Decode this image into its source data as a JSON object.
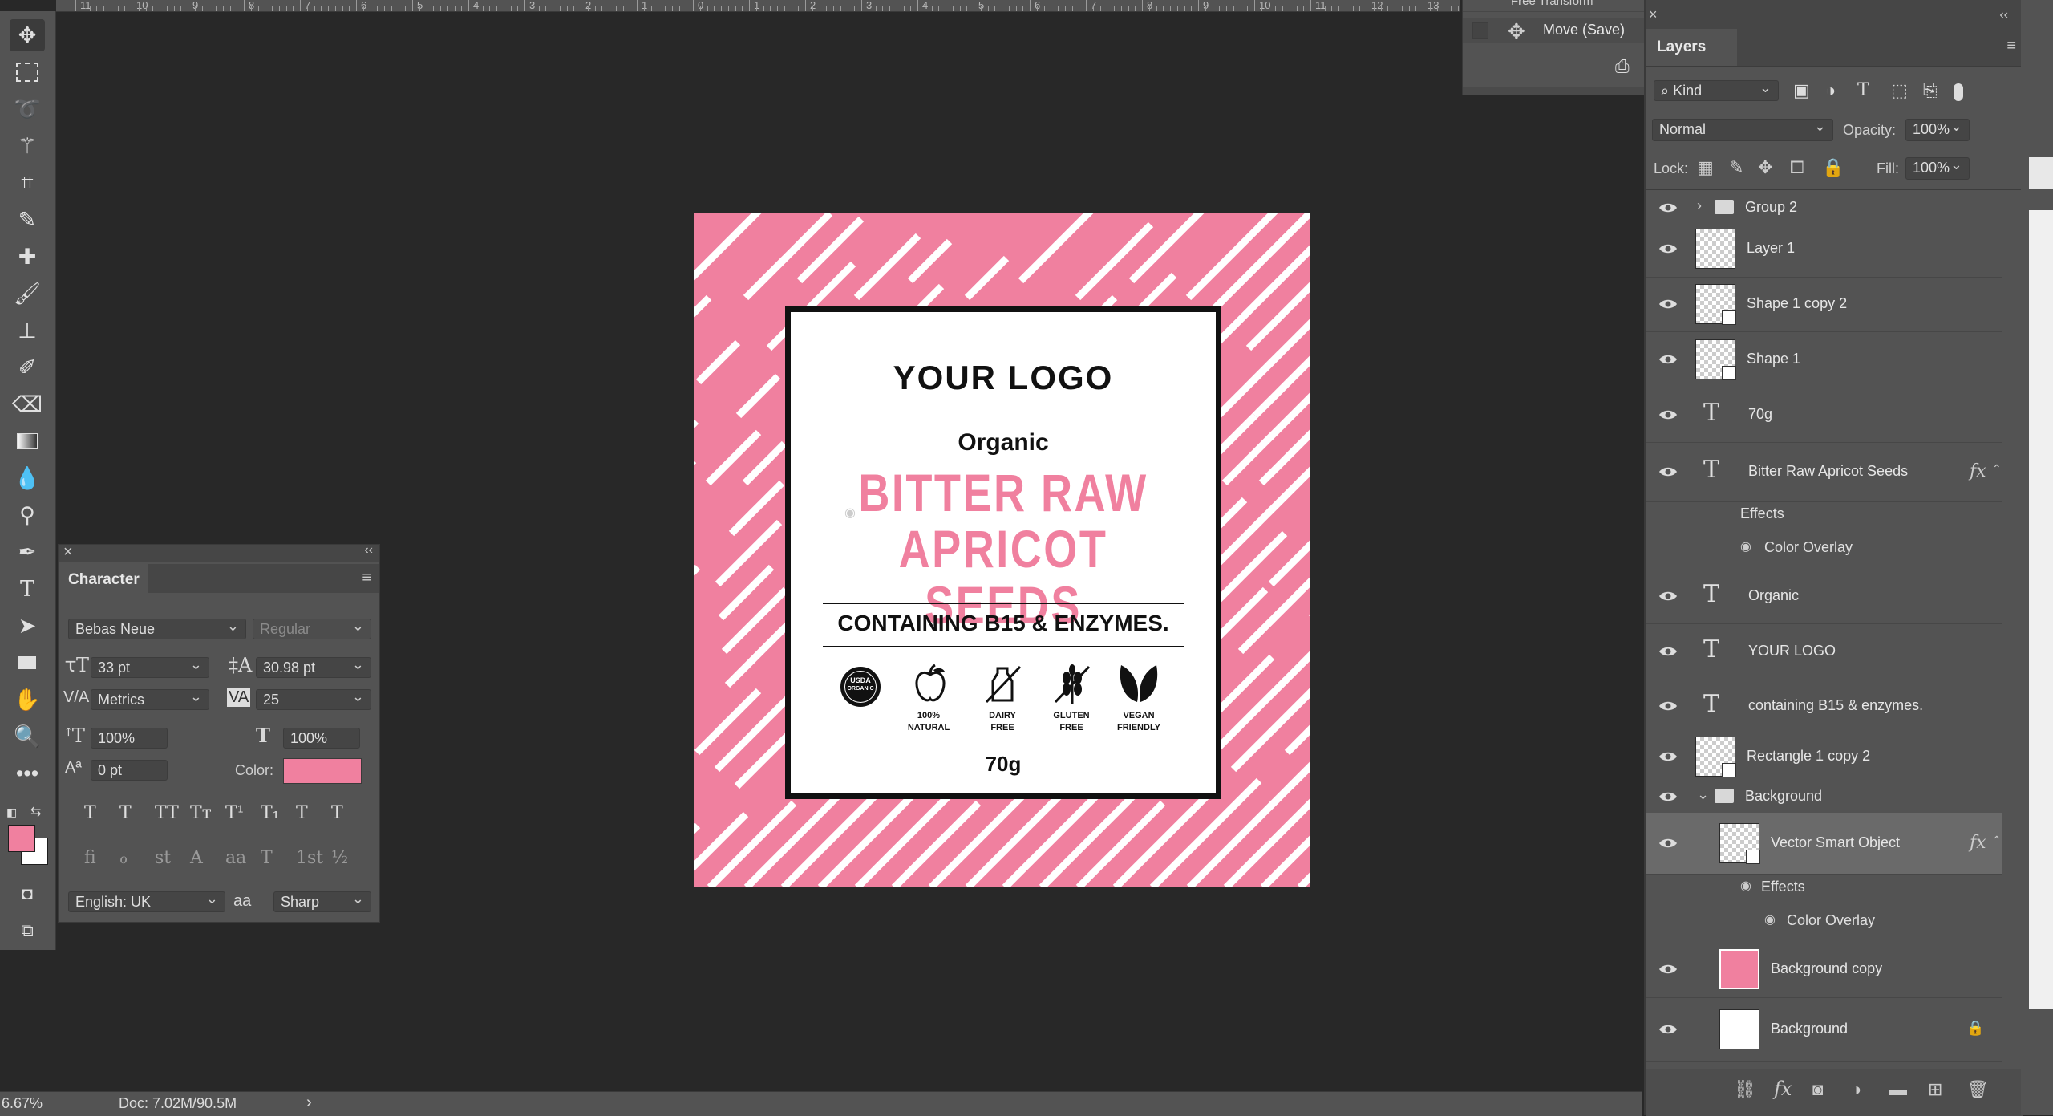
{
  "ruler": {
    "numbers": [
      "11",
      "10",
      "9",
      "8",
      "7",
      "6",
      "5",
      "4",
      "3",
      "2",
      "1",
      "0",
      "1",
      "2",
      "3",
      "4",
      "5",
      "6",
      "7",
      "8",
      "9",
      "10",
      "11",
      "12",
      "13"
    ]
  },
  "history": {
    "item_top": "Free Transform",
    "item": "Move (Save)"
  },
  "canvas": {
    "bg_color": "#f0809f",
    "logo": "YOUR LOGO",
    "organic": "Organic",
    "title1": "BITTER RAW",
    "title2": "APRICOT SEEDS",
    "subtitle": "CONTAINING B15 & ENZYMES.",
    "badges": [
      {
        "icon": "usda-organic-icon",
        "label1": "",
        "label2": "",
        "seal1": "USDA",
        "seal2": "ORGANIC"
      },
      {
        "icon": "apricot-icon",
        "label1": "100%",
        "label2": "NATURAL"
      },
      {
        "icon": "no-dairy-icon",
        "label1": "DAIRY",
        "label2": "FREE"
      },
      {
        "icon": "no-gluten-icon",
        "label1": "GLUTEN",
        "label2": "FREE"
      },
      {
        "icon": "leaf-icon",
        "label1": "VEGAN",
        "label2": "FRIENDLY"
      }
    ],
    "weight": "70g"
  },
  "character": {
    "title": "Character",
    "font_family": "Bebas Neue",
    "font_style": "Regular",
    "font_size": "33 pt",
    "leading": "30.98 pt",
    "kerning": "Metrics",
    "tracking": "25",
    "vscale": "100%",
    "hscale": "100%",
    "baseline": "0 pt",
    "color_label": "Color:",
    "color": "#f0809f",
    "language": "English: UK",
    "antialias": "Sharp",
    "aa_label": "aa",
    "style_glyphs": [
      "T",
      "T",
      "TT",
      "Tт",
      "T¹",
      "T₁",
      "T",
      "T"
    ],
    "ot_glyphs": [
      "fi",
      "ℴ",
      "st",
      "A",
      "aa",
      "T",
      "1st",
      "½"
    ]
  },
  "layers": {
    "title": "Layers",
    "filter": "Kind",
    "blend": "Normal",
    "opacity_label": "Opacity:",
    "opacity": "100%",
    "lock_label": "Lock:",
    "fill_label": "Fill:",
    "fill": "100%",
    "rows": [
      {
        "name": "Group 2",
        "type": "group"
      },
      {
        "name": "Layer 1",
        "type": "pixel"
      },
      {
        "name": "Shape 1 copy 2",
        "type": "shape"
      },
      {
        "name": "Shape 1",
        "type": "shape"
      },
      {
        "name": "70g",
        "type": "text"
      },
      {
        "name": "Bitter Raw Apricot Seeds",
        "type": "text",
        "fx": "fx"
      },
      {
        "name": "Effects",
        "type": "effects"
      },
      {
        "name": "Color Overlay",
        "type": "effect"
      },
      {
        "name": "Organic",
        "type": "text"
      },
      {
        "name": "YOUR LOGO",
        "type": "text"
      },
      {
        "name": "containing B15 & enzymes.",
        "type": "text"
      },
      {
        "name": "Rectangle 1 copy 2",
        "type": "shape"
      },
      {
        "name": "Background",
        "type": "group-open"
      },
      {
        "name": "Vector Smart Object",
        "type": "smart",
        "fx": "fx"
      },
      {
        "name": "Effects",
        "type": "effects"
      },
      {
        "name": "Color Overlay",
        "type": "effect"
      },
      {
        "name": "Background copy",
        "type": "fill-pink"
      },
      {
        "name": "Background",
        "type": "fill-white"
      }
    ]
  },
  "status": {
    "zoom": "6.67%",
    "doc": "Doc: 7.02M/90.5M"
  }
}
